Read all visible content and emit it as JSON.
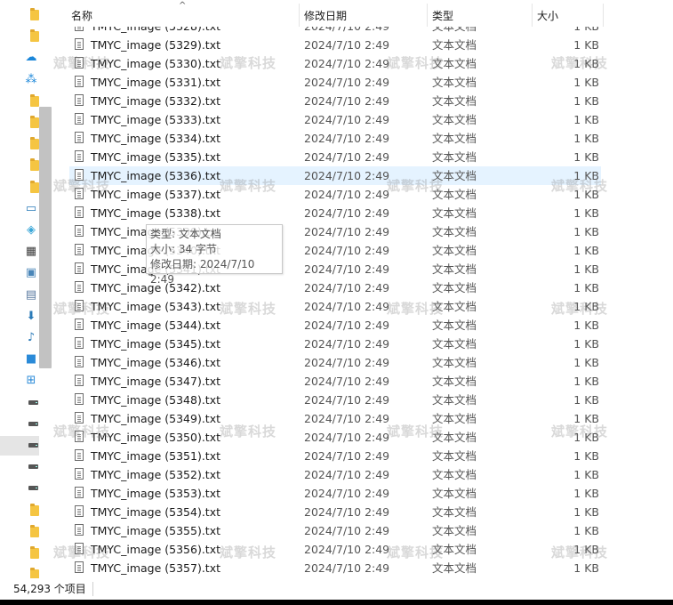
{
  "columns": {
    "name": "名称",
    "date": "修改日期",
    "type": "类型",
    "size": "大小"
  },
  "sort_indicator": "^",
  "partial_row": {
    "name": "TMYC_image (5328).txt",
    "date": "2024/7/10 2:49",
    "type": "文本文档",
    "size": "1 KB"
  },
  "files": [
    {
      "name": "TMYC_image (5329).txt",
      "date": "2024/7/10 2:49",
      "type": "文本文档",
      "size": "1 KB"
    },
    {
      "name": "TMYC_image (5330).txt",
      "date": "2024/7/10 2:49",
      "type": "文本文档",
      "size": "1 KB"
    },
    {
      "name": "TMYC_image (5331).txt",
      "date": "2024/7/10 2:49",
      "type": "文本文档",
      "size": "1 KB"
    },
    {
      "name": "TMYC_image (5332).txt",
      "date": "2024/7/10 2:49",
      "type": "文本文档",
      "size": "1 KB"
    },
    {
      "name": "TMYC_image (5333).txt",
      "date": "2024/7/10 2:49",
      "type": "文本文档",
      "size": "1 KB"
    },
    {
      "name": "TMYC_image (5334).txt",
      "date": "2024/7/10 2:49",
      "type": "文本文档",
      "size": "1 KB"
    },
    {
      "name": "TMYC_image (5335).txt",
      "date": "2024/7/10 2:49",
      "type": "文本文档",
      "size": "1 KB"
    },
    {
      "name": "TMYC_image (5336).txt",
      "date": "2024/7/10 2:49",
      "type": "文本文档",
      "size": "1 KB"
    },
    {
      "name": "TMYC_image (5337).txt",
      "date": "2024/7/10 2:49",
      "type": "文本文档",
      "size": "1 KB"
    },
    {
      "name": "TMYC_image (5338).txt",
      "date": "2024/7/10 2:49",
      "type": "文本文档",
      "size": "1 KB"
    },
    {
      "name": "TMYC_image (5339).txt",
      "date": "2024/7/10 2:49",
      "type": "文本文档",
      "size": "1 KB"
    },
    {
      "name": "TMYC_image (5340).txt",
      "date": "2024/7/10 2:49",
      "type": "文本文档",
      "size": "1 KB"
    },
    {
      "name": "TMYC_image (5341).txt",
      "date": "2024/7/10 2:49",
      "type": "文本文档",
      "size": "1 KB"
    },
    {
      "name": "TMYC_image (5342).txt",
      "date": "2024/7/10 2:49",
      "type": "文本文档",
      "size": "1 KB"
    },
    {
      "name": "TMYC_image (5343).txt",
      "date": "2024/7/10 2:49",
      "type": "文本文档",
      "size": "1 KB"
    },
    {
      "name": "TMYC_image (5344).txt",
      "date": "2024/7/10 2:49",
      "type": "文本文档",
      "size": "1 KB"
    },
    {
      "name": "TMYC_image (5345).txt",
      "date": "2024/7/10 2:49",
      "type": "文本文档",
      "size": "1 KB"
    },
    {
      "name": "TMYC_image (5346).txt",
      "date": "2024/7/10 2:49",
      "type": "文本文档",
      "size": "1 KB"
    },
    {
      "name": "TMYC_image (5347).txt",
      "date": "2024/7/10 2:49",
      "type": "文本文档",
      "size": "1 KB"
    },
    {
      "name": "TMYC_image (5348).txt",
      "date": "2024/7/10 2:49",
      "type": "文本文档",
      "size": "1 KB"
    },
    {
      "name": "TMYC_image (5349).txt",
      "date": "2024/7/10 2:49",
      "type": "文本文档",
      "size": "1 KB"
    },
    {
      "name": "TMYC_image (5350).txt",
      "date": "2024/7/10 2:49",
      "type": "文本文档",
      "size": "1 KB"
    },
    {
      "name": "TMYC_image (5351).txt",
      "date": "2024/7/10 2:49",
      "type": "文本文档",
      "size": "1 KB"
    },
    {
      "name": "TMYC_image (5352).txt",
      "date": "2024/7/10 2:49",
      "type": "文本文档",
      "size": "1 KB"
    },
    {
      "name": "TMYC_image (5353).txt",
      "date": "2024/7/10 2:49",
      "type": "文本文档",
      "size": "1 KB"
    },
    {
      "name": "TMYC_image (5354).txt",
      "date": "2024/7/10 2:49",
      "type": "文本文档",
      "size": "1 KB"
    },
    {
      "name": "TMYC_image (5355).txt",
      "date": "2024/7/10 2:49",
      "type": "文本文档",
      "size": "1 KB"
    },
    {
      "name": "TMYC_image (5356).txt",
      "date": "2024/7/10 2:49",
      "type": "文本文档",
      "size": "1 KB"
    },
    {
      "name": "TMYC_image (5357).txt",
      "date": "2024/7/10 2:49",
      "type": "文本文档",
      "size": "1 KB"
    }
  ],
  "hovered_file": "TMYC_image (5336).txt",
  "tooltip": {
    "type_line": "类型: 文本文档",
    "size_line": "大小: 34 字节",
    "date_line": "修改日期: 2024/7/10 2:49"
  },
  "watermark_text": "斌擎科技",
  "status": {
    "item_count": "54,293 个项目"
  },
  "nav_icons": [
    "folder-icon",
    "folder-icon",
    "onedrive-cloud-icon",
    "share-icon",
    "folder-icon",
    "folder-icon",
    "folder-icon",
    "folder-icon",
    "folder-icon",
    "this-pc-icon",
    "3d-objects-icon",
    "videos-icon",
    "pictures-icon",
    "documents-icon",
    "downloads-icon",
    "music-icon",
    "desktop-icon",
    "windows-drive-icon",
    "drive-icon",
    "drive-icon",
    "drive-icon",
    "drive-icon",
    "network-drive-icon",
    "folder-icon",
    "folder-icon",
    "folder-icon",
    "folder-icon"
  ],
  "colors": {
    "hover_row": "#e5f3ff",
    "selected_nav": "#e5e5e5",
    "folder": "#f5c542",
    "onedrive": "#1a86d9"
  }
}
